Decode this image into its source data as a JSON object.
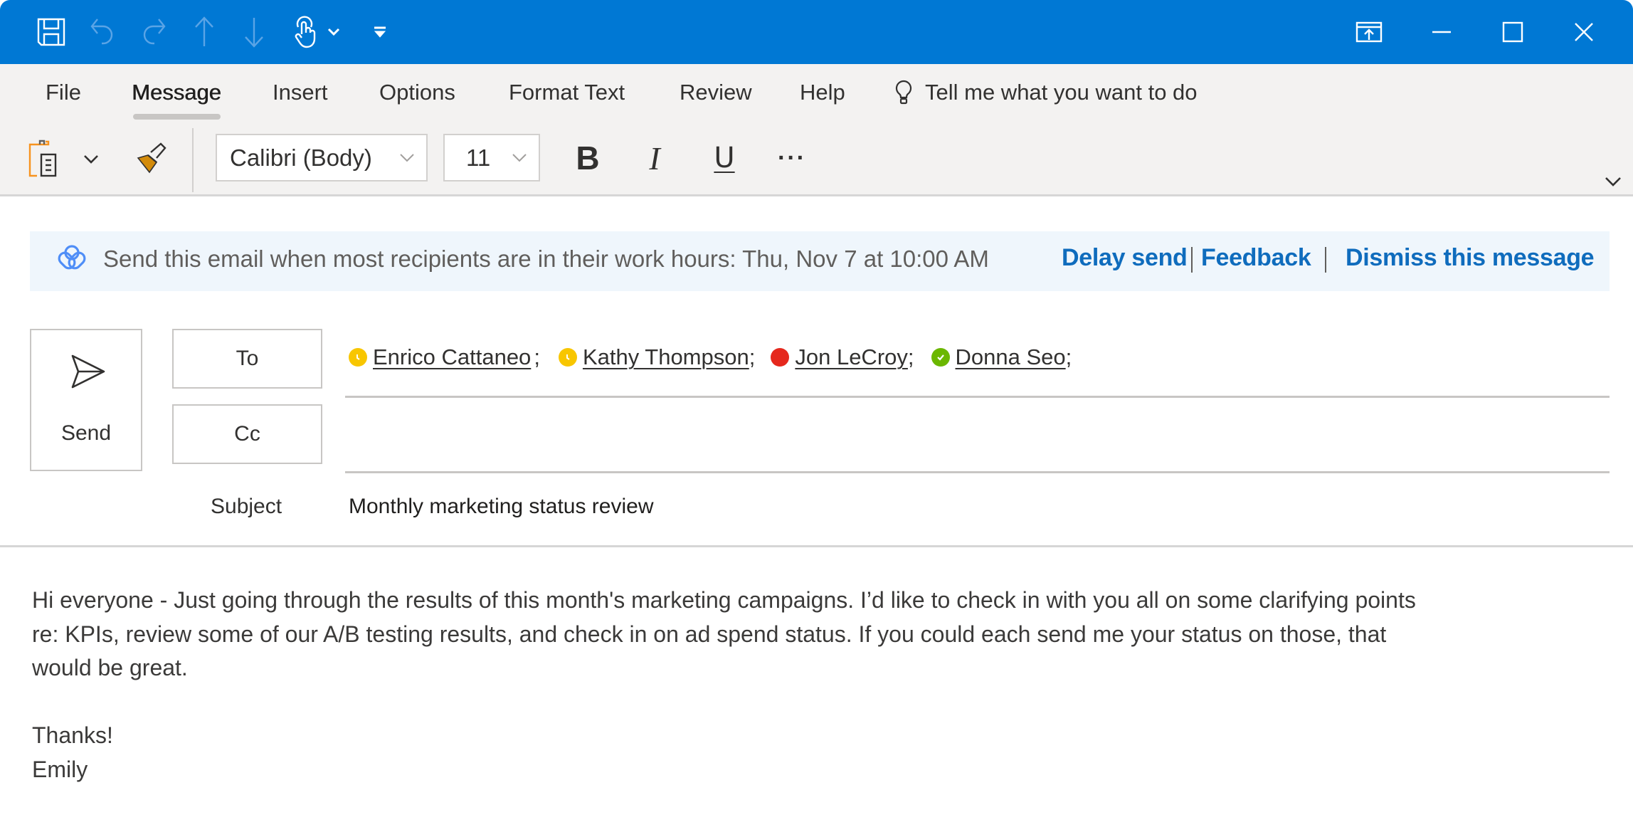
{
  "titlebar": {
    "quick_access": [
      {
        "name": "save-icon",
        "enabled": true
      },
      {
        "name": "undo-icon",
        "enabled": false
      },
      {
        "name": "redo-icon",
        "enabled": false
      },
      {
        "name": "previous-item-icon",
        "enabled": false
      },
      {
        "name": "next-item-icon",
        "enabled": false
      },
      {
        "name": "touch-mode-icon",
        "enabled": true
      },
      {
        "name": "chevron-down-icon",
        "enabled": true
      },
      {
        "name": "customize-toolbar-icon",
        "enabled": true
      }
    ],
    "window_controls": [
      "ribbon-display-options-icon",
      "minimize-icon",
      "maximize-icon",
      "close-icon"
    ],
    "accent_color": "#0078d4"
  },
  "ribbon": {
    "tabs": [
      {
        "label": "File",
        "active": false
      },
      {
        "label": "Message",
        "active": true
      },
      {
        "label": "Insert",
        "active": false
      },
      {
        "label": "Options",
        "active": false
      },
      {
        "label": "Format Text",
        "active": false
      },
      {
        "label": "Review",
        "active": false
      },
      {
        "label": "Help",
        "active": false
      }
    ],
    "tell_me": "Tell me what you want to do",
    "font_name": "Calibri (Body)",
    "font_size": "11",
    "bold_label": "B",
    "italic_label": "I",
    "underline_label": "U",
    "more_label": "···"
  },
  "banner": {
    "text": "Send this email when most recipients are in their work hours: Thu, Nov 7 at 10:00 AM",
    "delay_send": "Delay send",
    "feedback": "Feedback",
    "dismiss": "Dismiss this message",
    "link_color": "#0f6cbd"
  },
  "compose": {
    "send_label": "Send",
    "to_label": "To",
    "cc_label": "Cc",
    "subject_label": "Subject",
    "subject_value": "Monthly marketing status review",
    "cc_value": "",
    "recipients": [
      {
        "name": "Enrico Cattaneo",
        "separator": " ;",
        "presence": "away",
        "color": "#f8c600"
      },
      {
        "name": "Kathy Thompson",
        "separator": ";",
        "presence": "away",
        "color": "#f8c600"
      },
      {
        "name": "Jon LeCroy",
        "separator": ";",
        "presence": "busy",
        "color": "#e5281d"
      },
      {
        "name": "Donna Seo",
        "separator": ";",
        "presence": "available",
        "color": "#6bb700"
      }
    ]
  },
  "body": {
    "lines": [
      "Hi everyone - Just going through the results of this month's marketing campaigns. I’d like to check in with you all on some clarifying points",
      "re: KPIs, review some of our A/B testing results, and check in on ad spend status. If you could each send me your status on those, that",
      "would be great."
    ],
    "closing": "Thanks!",
    "signature": "Emily"
  }
}
